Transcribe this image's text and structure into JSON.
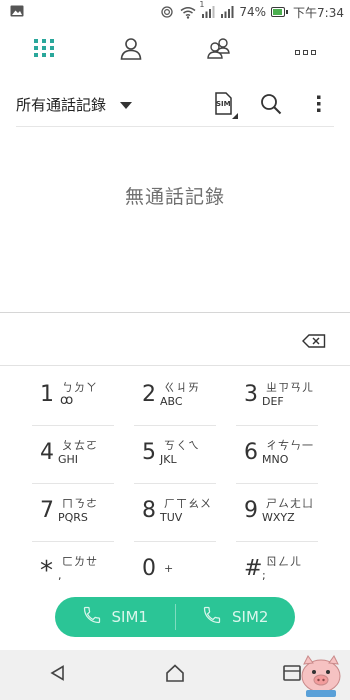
{
  "status_bar": {
    "battery": "74%",
    "time": "下午7:34",
    "sim_indicator": "1",
    "icons": [
      "image-icon",
      "vibrate-icon",
      "wifi-icon",
      "signal-icon",
      "signal-icon",
      "battery-icon"
    ]
  },
  "tabs": [
    {
      "name": "dialpad",
      "icon": "dialpad-icon",
      "active": true
    },
    {
      "name": "contacts",
      "icon": "person-icon",
      "active": false
    },
    {
      "name": "groups",
      "icon": "group-icon",
      "active": false
    },
    {
      "name": "more",
      "icon": "more-horizontal-icon",
      "active": false
    }
  ],
  "filter": {
    "label": "所有通話記錄",
    "sim_icon_label": "SIM"
  },
  "empty_message": "無通話記錄",
  "keypad": [
    {
      "num": "1",
      "zhuyin": "ㄅㄉㄚ",
      "latin": "ꝏ"
    },
    {
      "num": "2",
      "zhuyin": "ㄍㄐㄞ",
      "latin": "ABC"
    },
    {
      "num": "3",
      "zhuyin": "ㄓㄗㄢㄦ",
      "latin": "DEF"
    },
    {
      "num": "4",
      "zhuyin": "ㄆㄊㄛ",
      "latin": "GHI"
    },
    {
      "num": "5",
      "zhuyin": "ㄎㄑㄟ",
      "latin": "JKL"
    },
    {
      "num": "6",
      "zhuyin": "ㄔㄘㄣ一",
      "latin": "MNO"
    },
    {
      "num": "7",
      "zhuyin": "ㄇㄋㄜ",
      "latin": "PQRS"
    },
    {
      "num": "8",
      "zhuyin": "ㄏㄒㄠㄨ",
      "latin": "TUV"
    },
    {
      "num": "9",
      "zhuyin": "ㄕㄙㄤㄩ",
      "latin": "WXYZ"
    },
    {
      "num": "*",
      "zhuyin": "ㄈㄌㄝ",
      "latin": ","
    },
    {
      "num": "0",
      "zhuyin": "+",
      "latin": ""
    },
    {
      "num": "#",
      "zhuyin": "ㄖㄥㄦ",
      "latin": ";"
    }
  ],
  "call": {
    "sim1_label": "SIM1",
    "sim2_label": "SIM2",
    "color": "#2bc596"
  },
  "colors": {
    "accent": "#2bc596",
    "tab_active": "#2aa79b"
  }
}
